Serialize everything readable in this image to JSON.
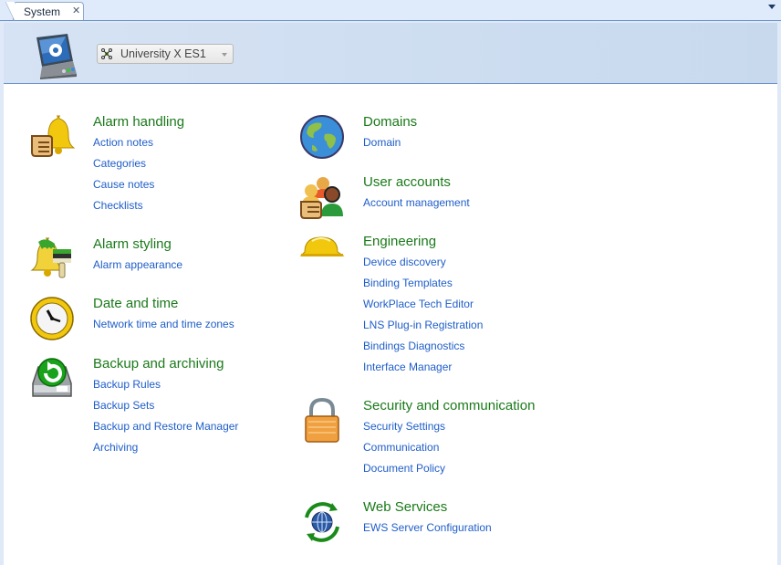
{
  "tabs": [
    {
      "label": "System",
      "close_icon": "close-icon"
    }
  ],
  "tab_menu_icon": "chevron-down-icon",
  "header": {
    "icon": "system-computer-icon",
    "server_select": {
      "icon": "server-network-icon",
      "value": "University X ES1"
    }
  },
  "colors": {
    "group_title": "#1a7a1a",
    "link": "#1f5ec9",
    "header_border": "#6b93c9"
  },
  "left_column": [
    {
      "title": "Alarm handling",
      "icon": "alarm-bell-hand-icon",
      "links": [
        "Action notes",
        "Categories",
        "Cause notes",
        "Checklists"
      ]
    },
    {
      "title": "Alarm styling",
      "icon": "alarm-bell-brush-icon",
      "links": [
        "Alarm appearance"
      ]
    },
    {
      "title": "Date and time",
      "icon": "clock-icon",
      "links": [
        "Network time and time zones"
      ]
    },
    {
      "title": "Backup and archiving",
      "icon": "backup-drive-icon",
      "links": [
        "Backup Rules",
        "Backup Sets",
        "Backup and Restore Manager",
        "Archiving"
      ]
    }
  ],
  "right_column": [
    {
      "title": "Domains",
      "icon": "globe-icon",
      "links": [
        "Domain"
      ]
    },
    {
      "title": "User accounts",
      "icon": "user-accounts-icon",
      "links": [
        "Account management"
      ]
    },
    {
      "title": "Engineering",
      "icon": "hard-hat-icon",
      "links": [
        "Device discovery",
        "Binding Templates",
        "WorkPlace Tech Editor",
        "LNS Plug-in Registration",
        "Bindings Diagnostics",
        "Interface Manager"
      ]
    },
    {
      "title": "Security and communication",
      "icon": "padlock-icon",
      "links": [
        "Security Settings",
        "Communication",
        "Document Policy"
      ]
    },
    {
      "title": "Web Services",
      "icon": "web-services-globe-icon",
      "links": [
        "EWS Server Configuration"
      ]
    }
  ]
}
